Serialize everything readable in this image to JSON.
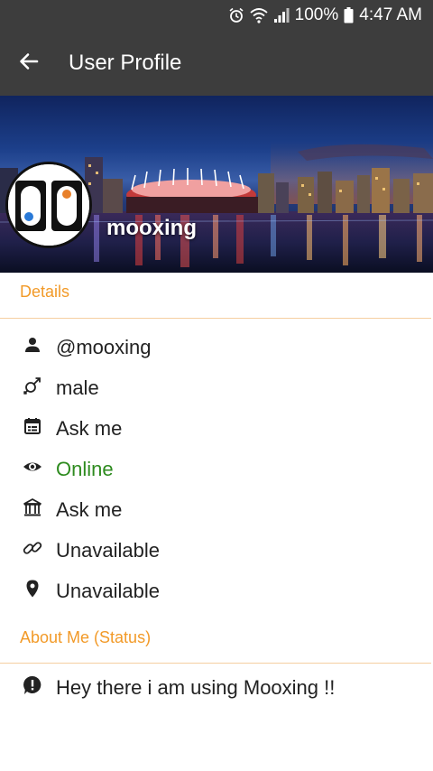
{
  "status_bar": {
    "battery": "100%",
    "time": "4:47 AM",
    "icons": [
      "alarm-icon",
      "wifi-icon",
      "signal-icon",
      "battery-icon"
    ]
  },
  "app_bar": {
    "title": "User Profile",
    "back_icon": "arrow-back-icon"
  },
  "profile": {
    "name": "mooxing"
  },
  "details": {
    "header": "Details",
    "items": [
      {
        "icon": "person-icon",
        "value": "@mooxing"
      },
      {
        "icon": "gender-icon",
        "value": "male"
      },
      {
        "icon": "calendar-icon",
        "value": "Ask me"
      },
      {
        "icon": "eye-icon",
        "value": "Online"
      },
      {
        "icon": "institution-icon",
        "value": "Ask me"
      },
      {
        "icon": "link-icon",
        "value": "Unavailable"
      },
      {
        "icon": "location-pin-icon",
        "value": "Unavailable"
      }
    ]
  },
  "about": {
    "header": "About Me (Status)",
    "icon": "info-icon",
    "status": "Hey there i am using Mooxing !!"
  },
  "colors": {
    "bar_background": "#3d3d3d",
    "section_header": "#f29a28",
    "online": "#2e8b1f"
  }
}
